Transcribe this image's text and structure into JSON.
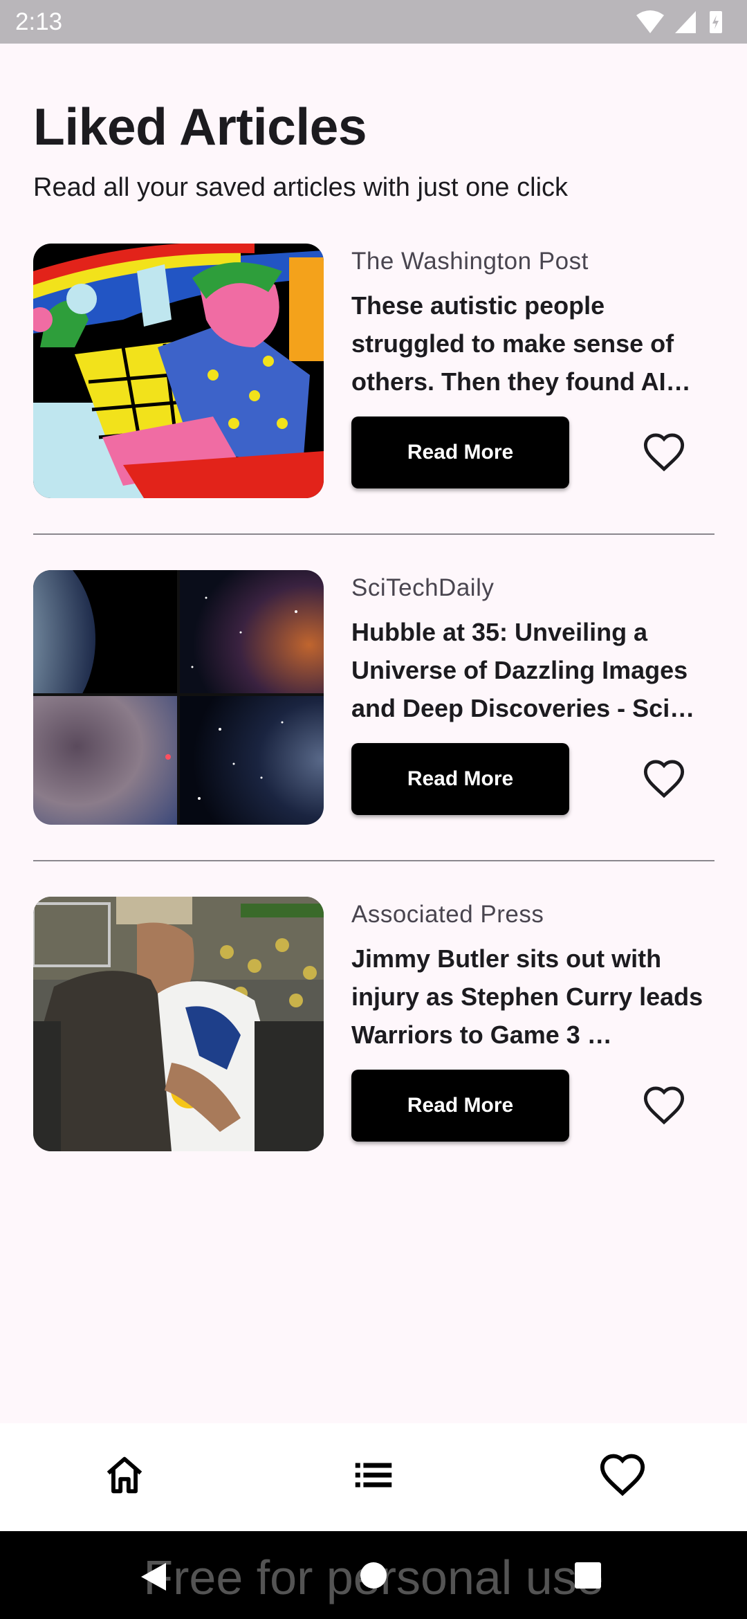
{
  "status_bar": {
    "time": "2:13"
  },
  "header": {
    "title": "Liked Articles",
    "subtitle": "Read all your saved articles with just one click"
  },
  "articles": [
    {
      "source": "The Washington Post",
      "headline": "These autistic people struggled to make sense of others. Then they found AI…",
      "button_label": "Read More",
      "liked_icon": "heart-outline-icon"
    },
    {
      "source": "SciTechDaily",
      "headline": "Hubble at 35: Unveiling a Universe of Dazzling Images and Deep Discoveries - Sci…",
      "button_label": "Read More",
      "liked_icon": "heart-outline-icon"
    },
    {
      "source": "Associated Press",
      "headline": "Jimmy Butler sits out with injury as Stephen Curry leads Warriors to Game 3 …",
      "button_label": "Read More",
      "liked_icon": "heart-outline-icon"
    }
  ],
  "bottom_nav": {
    "items": [
      {
        "icon": "home-icon"
      },
      {
        "icon": "list-icon"
      },
      {
        "icon": "heart-icon"
      }
    ]
  },
  "watermark": "Free for personal use",
  "colors": {
    "background": "#fef7fb",
    "button": "#000000",
    "status_bar": "#b9b6ba"
  }
}
